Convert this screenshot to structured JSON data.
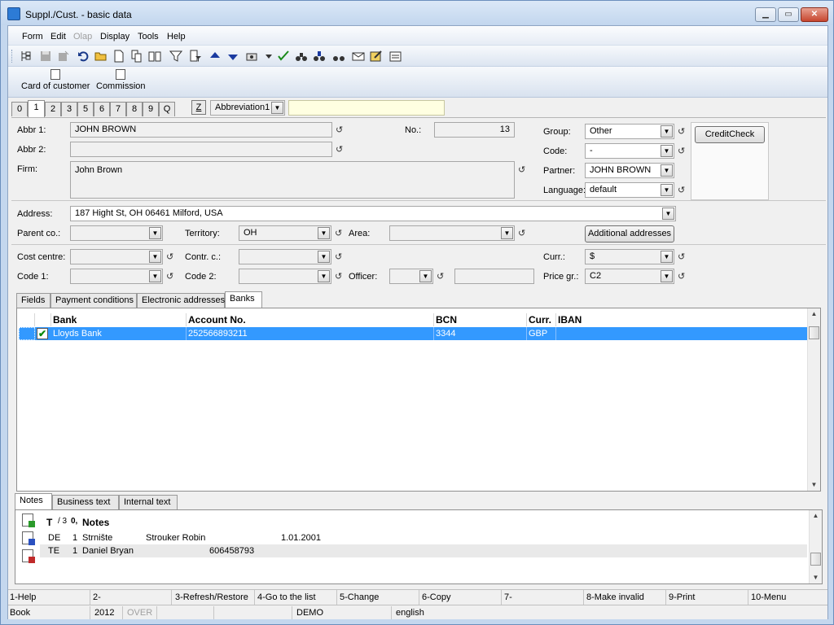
{
  "window": {
    "title": "Suppl./Cust. - basic data",
    "minimize": "▁",
    "maximize": "▭",
    "close": "✕"
  },
  "menu": [
    "Form",
    "Edit",
    "Olap",
    "Display",
    "Tools",
    "Help"
  ],
  "toolbar2": {
    "card_label": "Card of customer",
    "commission_label": "Commission"
  },
  "numtabs": [
    "0",
    "1",
    "2",
    "3",
    "5",
    "6",
    "7",
    "8",
    "9",
    "Q"
  ],
  "active_numtab": "1",
  "sort": {
    "z_label": "Z",
    "combo_value": "Abbreviation1"
  },
  "form": {
    "abbr1_label": "Abbr 1:",
    "abbr1_value": "JOHN BROWN",
    "abbr2_label": "Abbr 2:",
    "abbr2_value": "",
    "firm_label": "Firm:",
    "firm_value": "John Brown",
    "no_label": "No.:",
    "no_value": "13",
    "group_label": "Group:",
    "group_value": "Other",
    "code_label": "Code:",
    "code_value": "-",
    "partner_label": "Partner:",
    "partner_value": "JOHN BROWN",
    "language_label": "Language:",
    "language_value": "default",
    "creditcheck_label": "CreditCheck",
    "address_label": "Address:",
    "address_value": "187  Hight St, OH 06461  Milford, USA",
    "parentco_label": "Parent co.:",
    "parentco_value": "",
    "territory_label": "Territory:",
    "territory_value": "OH",
    "area_label": "Area:",
    "area_value": "",
    "additional_addresses_label": "Additional addresses",
    "costcentre_label": "Cost centre:",
    "costcentre_value": "",
    "contrc_label": "Contr. c.:",
    "contrc_value": "",
    "curr_label": "Curr.:",
    "curr_value": "$",
    "code1_label": "Code 1:",
    "code1_value": "",
    "code2_label": "Code 2:",
    "code2_value": "",
    "officer_label": "Officer:",
    "officer_value": "",
    "pricegr_label": "Price gr.:",
    "pricegr_value": "C2"
  },
  "subtabs": [
    "Fields",
    "Payment conditions",
    "Electronic addresses",
    "Banks"
  ],
  "active_subtab": "Banks",
  "banks": {
    "headers": {
      "bank": "Bank",
      "account": "Account No.",
      "bcn": "BCN",
      "curr": "Curr.",
      "iban": "IBAN"
    },
    "rows": [
      {
        "bank": "Lloyds Bank",
        "account": "252566893211",
        "bcn": "3344",
        "curr": "GBP",
        "iban": ""
      }
    ]
  },
  "notetabs": [
    "Notes",
    "Business text",
    "Internal text"
  ],
  "active_notetab": "Notes",
  "notes": {
    "headers": {
      "t": "T",
      "seq": "/ 3",
      "attach": "0,",
      "notes": "Notes"
    },
    "rows": [
      {
        "t": "DE",
        "n": "1",
        "c1": "Strnište",
        "c2": "Strouker Robin",
        "c3": "1.01.2001"
      },
      {
        "t": "TE",
        "n": "1",
        "c1": "Daniel Bryan",
        "c2": "606458793",
        "c3": ""
      }
    ]
  },
  "fkeys": [
    "1-Help",
    "2-",
    "3-Refresh/Restore",
    "4-Go to the list",
    "5-Change",
    "6-Copy",
    "7-",
    "8-Make invalid",
    "9-Print",
    "10-Menu"
  ],
  "status": {
    "book": "Book",
    "year": "2012",
    "over": "OVER",
    "db": "DEMO",
    "lang": "english"
  },
  "colors": {
    "selection": "#3399ff",
    "accent": "#c4d7ee",
    "highlight_field": "#ffffe1"
  }
}
